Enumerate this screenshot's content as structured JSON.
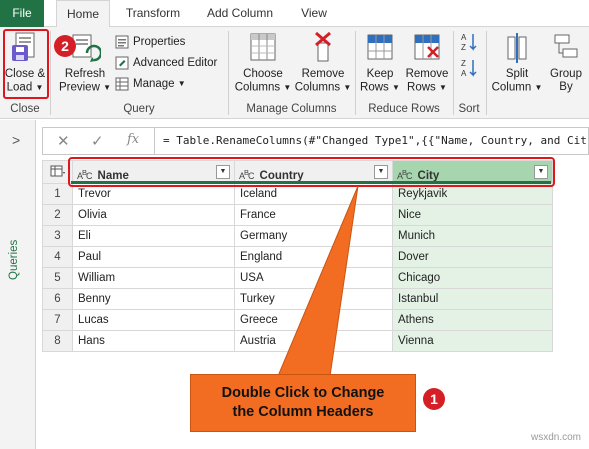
{
  "tabs": [
    {
      "label": "File"
    },
    {
      "label": "Home"
    },
    {
      "label": "Transform"
    },
    {
      "label": "Add Column"
    },
    {
      "label": "View"
    }
  ],
  "ribbon": {
    "close_load": {
      "line1": "Close &",
      "line2": "Load",
      "group": "Close"
    },
    "refresh": {
      "line1": "Refresh",
      "line2": "Preview"
    },
    "properties": "Properties",
    "advanced_editor": "Advanced Editor",
    "manage": "Manage",
    "query_group": "Query",
    "choose_columns": {
      "line1": "Choose",
      "line2": "Columns"
    },
    "remove_columns": {
      "line1": "Remove",
      "line2": "Columns"
    },
    "manage_columns_group": "Manage Columns",
    "keep_rows": {
      "line1": "Keep",
      "line2": "Rows"
    },
    "remove_rows": {
      "line1": "Remove",
      "line2": "Rows"
    },
    "reduce_rows_group": "Reduce Rows",
    "sort_group": "Sort",
    "split_column": {
      "line1": "Split",
      "line2": "Column"
    },
    "group_by": {
      "line1": "Group",
      "line2": "By"
    }
  },
  "badges": {
    "step2": "2",
    "step1": "1"
  },
  "queries_panel": {
    "chevron": ">",
    "label": "Queries"
  },
  "formula_bar": {
    "cancel": "✕",
    "confirm": "✓",
    "fx": "fx",
    "formula": "= Table.RenameColumns(#\"Changed Type1\",{{\"Name, Country, and Cit"
  },
  "table": {
    "columns": [
      "Name",
      "Country",
      "City"
    ],
    "type_label": "ABC",
    "rows": [
      {
        "n": "1",
        "name": "Trevor",
        "country": "Iceland",
        "city": "Reykjavik"
      },
      {
        "n": "2",
        "name": "Olivia",
        "country": "France",
        "city": "Nice"
      },
      {
        "n": "3",
        "name": "Eli",
        "country": "Germany",
        "city": "Munich"
      },
      {
        "n": "4",
        "name": "Paul",
        "country": "England",
        "city": "Dover"
      },
      {
        "n": "5",
        "name": "William",
        "country": "USA",
        "city": "Chicago"
      },
      {
        "n": "6",
        "name": "Benny",
        "country": "Turkey",
        "city": "Istanbul"
      },
      {
        "n": "7",
        "name": "Lucas",
        "country": "Greece",
        "city": "Athens"
      },
      {
        "n": "8",
        "name": "Hans",
        "country": "Austria",
        "city": "Vienna"
      }
    ]
  },
  "callout": {
    "line1": "Double Click to Change",
    "line2": "the Column Headers"
  },
  "watermark": "wsxdn.com",
  "colors": {
    "accent": "#217346",
    "annotation_red": "#e0161c",
    "callout_orange": "#f26d21",
    "selected_column": "#a6d5ae"
  }
}
